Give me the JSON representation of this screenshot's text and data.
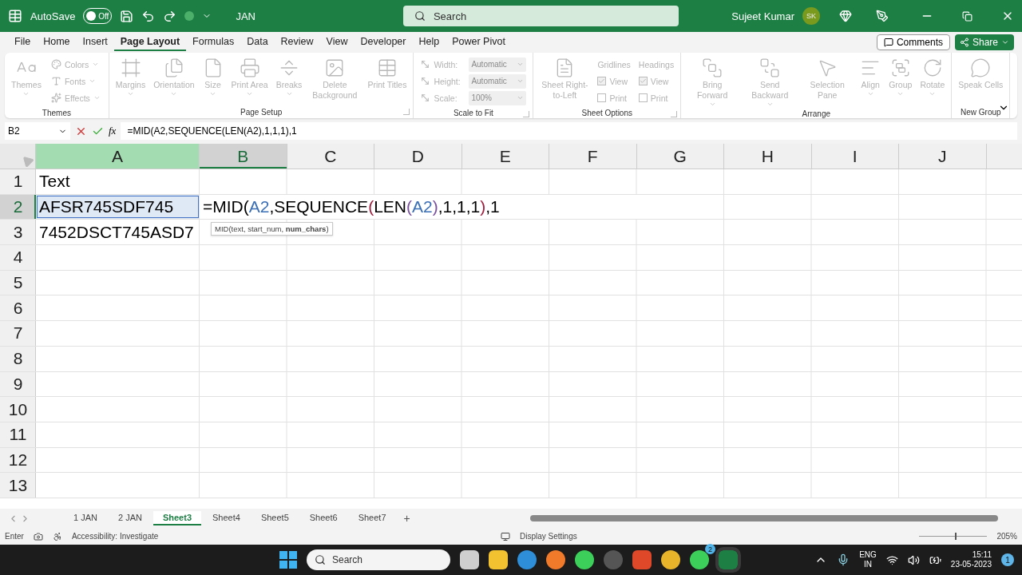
{
  "title_bar": {
    "autosave_label": "AutoSave",
    "autosave_on": false,
    "autosave_state": "Off",
    "file_name": "JAN",
    "search_placeholder": "Search",
    "user_name": "Sujeet Kumar",
    "user_initials": "SK"
  },
  "menu": [
    {
      "label": "File",
      "selected": false
    },
    {
      "label": "Home",
      "selected": false
    },
    {
      "label": "Insert",
      "selected": false
    },
    {
      "label": "Page Layout",
      "selected": true
    },
    {
      "label": "Formulas",
      "selected": false
    },
    {
      "label": "Data",
      "selected": false
    },
    {
      "label": "Review",
      "selected": false
    },
    {
      "label": "View",
      "selected": false
    },
    {
      "label": "Developer",
      "selected": false
    },
    {
      "label": "Help",
      "selected": false
    },
    {
      "label": "Power Pivot",
      "selected": false
    }
  ],
  "comments_button": "Comments",
  "share_button": "Share",
  "ribbon": {
    "disabled": true,
    "groups": [
      {
        "title": "Themes",
        "launcher": false,
        "items": [
          {
            "kind": "large",
            "label": "Themes",
            "dropdown": true
          },
          {
            "kind": "stack",
            "items": [
              {
                "label": "Colors"
              },
              {
                "label": "Fonts"
              },
              {
                "label": "Effects"
              }
            ]
          }
        ]
      },
      {
        "title": "Page Setup",
        "launcher": true,
        "items": [
          {
            "kind": "large",
            "label": "Margins",
            "dropdown": true
          },
          {
            "kind": "large",
            "label": "Orientation",
            "dropdown": true
          },
          {
            "kind": "large",
            "label": "Size",
            "dropdown": true
          },
          {
            "kind": "large",
            "label": "Print Area",
            "dropdown": true
          },
          {
            "kind": "large",
            "label": "Breaks",
            "dropdown": true
          },
          {
            "kind": "large",
            "label": "Delete Background",
            "dropdown": false
          },
          {
            "kind": "large",
            "label": "Print Titles",
            "dropdown": false
          }
        ]
      },
      {
        "title": "Scale to Fit",
        "launcher": true,
        "items": [
          {
            "kind": "fields",
            "items": [
              {
                "label": "Width:",
                "value": "Automatic"
              },
              {
                "label": "Height:",
                "value": "Automatic"
              },
              {
                "label": "Scale:",
                "value": "100%"
              }
            ]
          }
        ]
      },
      {
        "title": "Sheet Options",
        "launcher": true,
        "items": [
          {
            "kind": "large",
            "label": "Sheet Right-to-Left",
            "dropdown": false
          },
          {
            "kind": "checks",
            "heading": "Gridlines",
            "items": [
              {
                "label": "View",
                "checked": true
              },
              {
                "label": "Print",
                "checked": false
              }
            ]
          },
          {
            "kind": "checks",
            "heading": "Headings",
            "items": [
              {
                "label": "View",
                "checked": true
              },
              {
                "label": "Print",
                "checked": false
              }
            ]
          }
        ]
      },
      {
        "title": "Arrange",
        "launcher": false,
        "items": [
          {
            "kind": "large",
            "label": "Bring Forward",
            "dropdown": true
          },
          {
            "kind": "large",
            "label": "Send Backward",
            "dropdown": true
          },
          {
            "kind": "large",
            "label": "Selection Pane",
            "dropdown": false
          },
          {
            "kind": "large",
            "label": "Align",
            "dropdown": true
          },
          {
            "kind": "large",
            "label": "Group",
            "dropdown": true
          },
          {
            "kind": "large",
            "label": "Rotate",
            "dropdown": true
          }
        ]
      },
      {
        "title": "New Group",
        "launcher": false,
        "items": [
          {
            "kind": "large",
            "label": "Speak Cells",
            "dropdown": false
          }
        ]
      }
    ]
  },
  "formula_bar": {
    "name_box": "B2",
    "formula": "=MID(A2,SEQUENCE(LEN(A2),1,1,1),1"
  },
  "function_button": "fx",
  "columns": [
    {
      "label": "A",
      "referenced": true,
      "active": false
    },
    {
      "label": "B",
      "referenced": false,
      "active": true
    },
    {
      "label": "C",
      "referenced": false,
      "active": false
    },
    {
      "label": "D",
      "referenced": false,
      "active": false
    },
    {
      "label": "E",
      "referenced": false,
      "active": false
    },
    {
      "label": "F",
      "referenced": false,
      "active": false
    },
    {
      "label": "G",
      "referenced": false,
      "active": false
    },
    {
      "label": "H",
      "referenced": false,
      "active": false
    },
    {
      "label": "I",
      "referenced": false,
      "active": false
    },
    {
      "label": "J",
      "referenced": false,
      "active": false
    }
  ],
  "rows": [
    {
      "label": "1",
      "active": false,
      "cells": [
        {
          "text": "Text",
          "referenced": false
        }
      ]
    },
    {
      "label": "2",
      "active": true,
      "cells": [
        {
          "text": "AFSR745SDF745",
          "referenced": true
        }
      ],
      "edit_cell": {
        "segments": [
          {
            "text": "=MID(",
            "color": "#000000"
          },
          {
            "text": "A2",
            "color": "#3b6fb6"
          },
          {
            "text": ",SEQUENCE",
            "color": "#000000"
          },
          {
            "text": "(",
            "color": "#a02040"
          },
          {
            "text": "LEN",
            "color": "#000000"
          },
          {
            "text": "(",
            "color": "#7a4fa0"
          },
          {
            "text": "A2",
            "color": "#3b6fb6"
          },
          {
            "text": ")",
            "color": "#7a4fa0"
          },
          {
            "text": ",1,1,1",
            "color": "#000000"
          },
          {
            "text": ")",
            "color": "#a02040"
          },
          {
            "text": ",1",
            "color": "#000000"
          }
        ],
        "tooltip": "MID(text, start_num, **num_chars**)"
      }
    },
    {
      "label": "3",
      "active": false,
      "cells": [
        {
          "text": "7452DSCT745ASD7",
          "referenced": false
        }
      ]
    },
    {
      "label": "4",
      "active": false,
      "cells": []
    },
    {
      "label": "5",
      "active": false,
      "cells": []
    },
    {
      "label": "6",
      "active": false,
      "cells": []
    },
    {
      "label": "7",
      "active": false,
      "cells": []
    },
    {
      "label": "8",
      "active": false,
      "cells": []
    },
    {
      "label": "9",
      "active": false,
      "cells": []
    },
    {
      "label": "10",
      "active": false,
      "cells": []
    },
    {
      "label": "11",
      "active": false,
      "cells": []
    },
    {
      "label": "12",
      "active": false,
      "cells": []
    },
    {
      "label": "13",
      "active": false,
      "cells": []
    }
  ],
  "sheet_tabs": [
    {
      "label": "1 JAN",
      "selected": false
    },
    {
      "label": "2 JAN",
      "selected": false
    },
    {
      "label": "Sheet3",
      "selected": true
    },
    {
      "label": "Sheet4",
      "selected": false
    },
    {
      "label": "Sheet5",
      "selected": false
    },
    {
      "label": "Sheet6",
      "selected": false
    },
    {
      "label": "Sheet7",
      "selected": false
    }
  ],
  "add_sheet": "+",
  "status_bar": {
    "mode": "Enter",
    "accessibility": "Accessibility: Investigate",
    "display": "Display Settings",
    "zoom": "205%",
    "zoom_level": {
      "level": 0.52
    }
  },
  "taskbar": {
    "search_placeholder": "Search",
    "chat_badge": "2",
    "language": [
      "ENG",
      "IN"
    ],
    "time": "15:11",
    "date": "23-05-2023",
    "notifications": "1"
  }
}
